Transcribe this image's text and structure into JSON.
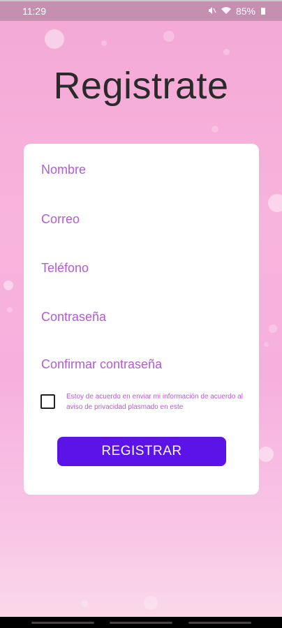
{
  "status_bar": {
    "time": "11:29",
    "mute_icon": "mute-icon",
    "wifi_icon": "wifi-icon",
    "battery": "85%"
  },
  "page": {
    "title": "Registrate"
  },
  "form": {
    "nombre_placeholder": "Nombre",
    "correo_placeholder": "Correo",
    "telefono_placeholder": "Teléfono",
    "contrasena_placeholder": "Contraseña",
    "confirmar_placeholder": "Confirmar contraseña",
    "consent_text": "Estoy de acuerdo en enviar mi información de acuerdo al aviso de privacidad plasmado en este",
    "submit_label": "REGISTRAR"
  },
  "colors": {
    "accent": "#5b13e8",
    "field_text": "#b35bd6",
    "background": "#f6b0de"
  }
}
